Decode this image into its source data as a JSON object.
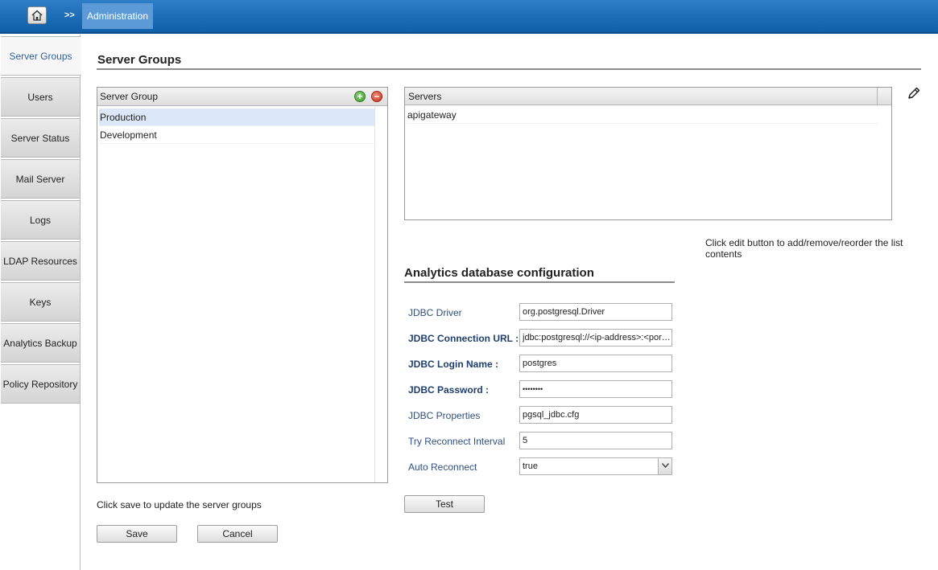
{
  "header": {
    "home_icon": "home-icon",
    "separator": ">>",
    "breadcrumb": "Administration"
  },
  "sidebar": {
    "items": [
      {
        "label": "Server Groups",
        "active": true
      },
      {
        "label": "Users"
      },
      {
        "label": "Server Status"
      },
      {
        "label": "Mail Server"
      },
      {
        "label": "Logs"
      },
      {
        "label": "LDAP Resources"
      },
      {
        "label": "Keys"
      },
      {
        "label": "Analytics Backup"
      },
      {
        "label": "Policy Repository"
      }
    ]
  },
  "main": {
    "title": "Server Groups",
    "server_groups": {
      "header": "Server Group",
      "add_icon": "add-circle-icon",
      "remove_icon": "remove-circle-icon",
      "rows": [
        "Production",
        "Development"
      ],
      "selected": "Production"
    },
    "servers": {
      "header": "Servers",
      "rows": [
        "apigateway"
      ],
      "edit_icon": "pencil-icon"
    },
    "edit_hint": "Click edit button to add/remove/reorder the list contents",
    "analytics": {
      "title": "Analytics database configuration",
      "fields": {
        "driver": {
          "label": "JDBC Driver",
          "value": "org.postgresql.Driver"
        },
        "url": {
          "label": "JDBC Connection URL :",
          "value": "jdbc:postgresql://<ip-address>:<port>/<db>"
        },
        "login": {
          "label": "JDBC Login Name :",
          "value": "postgres"
        },
        "password": {
          "label": "JDBC Password :",
          "value": "••••••••"
        },
        "properties": {
          "label": "JDBC Properties",
          "value": "pgsql_jdbc.cfg"
        },
        "reconnect_interval": {
          "label": "Try Reconnect Interval",
          "value": "5"
        },
        "auto_reconnect": {
          "label": "Auto Reconnect",
          "value": "true"
        }
      },
      "test_label": "Test"
    },
    "save_hint": "Click save to update the server groups",
    "save_label": "Save",
    "cancel_label": "Cancel"
  },
  "colors": {
    "header_bar": "#1a6bb5",
    "active_tab_text": "#2d5fa6",
    "form_label": "#2f4f7f"
  }
}
